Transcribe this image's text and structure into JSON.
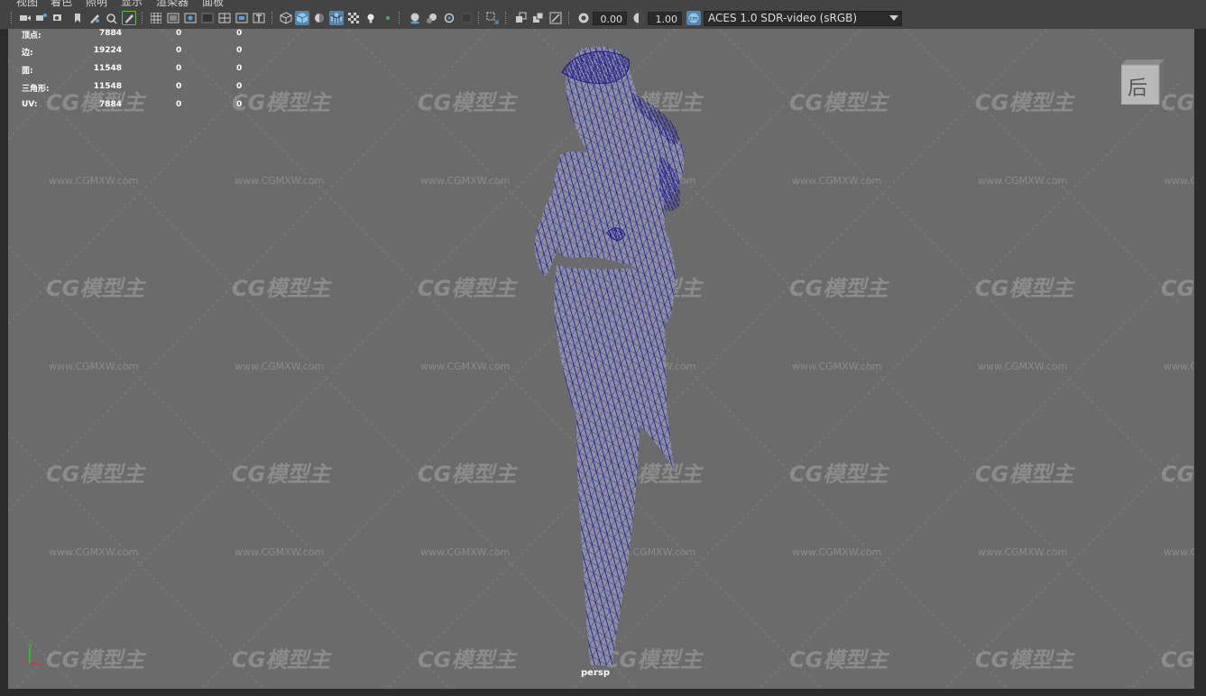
{
  "menu": {
    "items": [
      "视图",
      "着色",
      "照明",
      "显示",
      "渲染器",
      "面板"
    ]
  },
  "toolbar": {
    "exposure_value": "0.00",
    "gamma_value": "1.00",
    "color_management": "ACES 1.0 SDR-video (sRGB)",
    "icons": [
      "camera-select-icon",
      "camera-attributes-icon",
      "bookmark-icon",
      "image-plane-icon",
      "2d-pan-zoom-icon",
      "grease-pencil-icon",
      "grid-icon",
      "film-gate-icon",
      "resolution-gate-icon",
      "gate-mask-icon",
      "field-chart-icon",
      "safe-action-icon",
      "safe-title-icon",
      "wireframe-icon",
      "smooth-shade-icon",
      "default-material-icon",
      "wireframe-on-shaded-icon",
      "textured-icon",
      "use-all-lights-icon",
      "shadows-icon",
      "screen-space-ao-icon",
      "motion-blur-icon",
      "multisample-aa-icon",
      "depth-of-field-icon",
      "isolate-select-icon",
      "xray-icon",
      "xray-joints-icon",
      "backface-culling-icon",
      "exposure-icon",
      "gamma-icon",
      "view-transform-icon"
    ]
  },
  "hud": {
    "rows": [
      {
        "label": "顶点:",
        "v1": "7884",
        "v2": "0",
        "v3": "0"
      },
      {
        "label": "边:",
        "v1": "19224",
        "v2": "0",
        "v3": "0"
      },
      {
        "label": "面:",
        "v1": "11548",
        "v2": "0",
        "v3": "0"
      },
      {
        "label": "三角形:",
        "v1": "11548",
        "v2": "0",
        "v3": "0"
      },
      {
        "label": "UV:",
        "v1": "7884",
        "v2": "0",
        "v3": "0"
      }
    ]
  },
  "viewcube": {
    "face_label": "后"
  },
  "camera_label": "persp",
  "axis": {
    "y": "y",
    "x": "x"
  },
  "watermark": {
    "logo": "CG模型主",
    "url": "www.CGMXW.com"
  },
  "colors": {
    "viewport_bg": "#6b6b6b",
    "wireframe": "#1c1a8c",
    "toolbar_bg": "#444444",
    "accent": "#5285a6"
  }
}
